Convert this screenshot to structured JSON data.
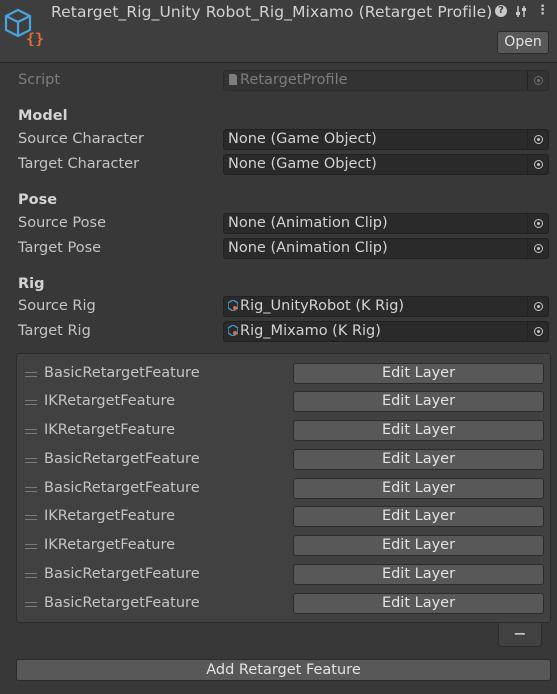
{
  "header": {
    "title": "Retarget_Rig_Unity Robot_Rig_Mixamo (Retarget Profile)",
    "open_label": "Open",
    "icons": [
      "help-icon",
      "preset-icon",
      "more-options-icon"
    ]
  },
  "script_row": {
    "label": "Script",
    "value": "RetargetProfile"
  },
  "model": {
    "title": "Model",
    "source_label": "Source Character",
    "source_value": "None (Game Object)",
    "target_label": "Target Character",
    "target_value": "None (Game Object)"
  },
  "pose": {
    "title": "Pose",
    "source_label": "Source Pose",
    "source_value": "None (Animation Clip)",
    "target_label": "Target Pose",
    "target_value": "None (Animation Clip)"
  },
  "rig": {
    "title": "Rig",
    "source_label": "Source Rig",
    "source_value": "Rig_UnityRobot (K Rig)",
    "target_label": "Target Rig",
    "target_value": "Rig_Mixamo (K Rig)"
  },
  "features": [
    {
      "name": "BasicRetargetFeature",
      "button": "Edit Layer"
    },
    {
      "name": "IKRetargetFeature",
      "button": "Edit Layer"
    },
    {
      "name": "IKRetargetFeature",
      "button": "Edit Layer"
    },
    {
      "name": "BasicRetargetFeature",
      "button": "Edit Layer"
    },
    {
      "name": "BasicRetargetFeature",
      "button": "Edit Layer"
    },
    {
      "name": "IKRetargetFeature",
      "button": "Edit Layer"
    },
    {
      "name": "IKRetargetFeature",
      "button": "Edit Layer"
    },
    {
      "name": "BasicRetargetFeature",
      "button": "Edit Layer"
    },
    {
      "name": "BasicRetargetFeature",
      "button": "Edit Layer"
    }
  ],
  "remove_label": "−",
  "add_label": "Add Retarget Feature",
  "colors": {
    "background": "#383838",
    "field": "#2a2a2a",
    "button": "#585858",
    "accent_icon": "#4aa3df",
    "brace": "#e06c3c"
  }
}
